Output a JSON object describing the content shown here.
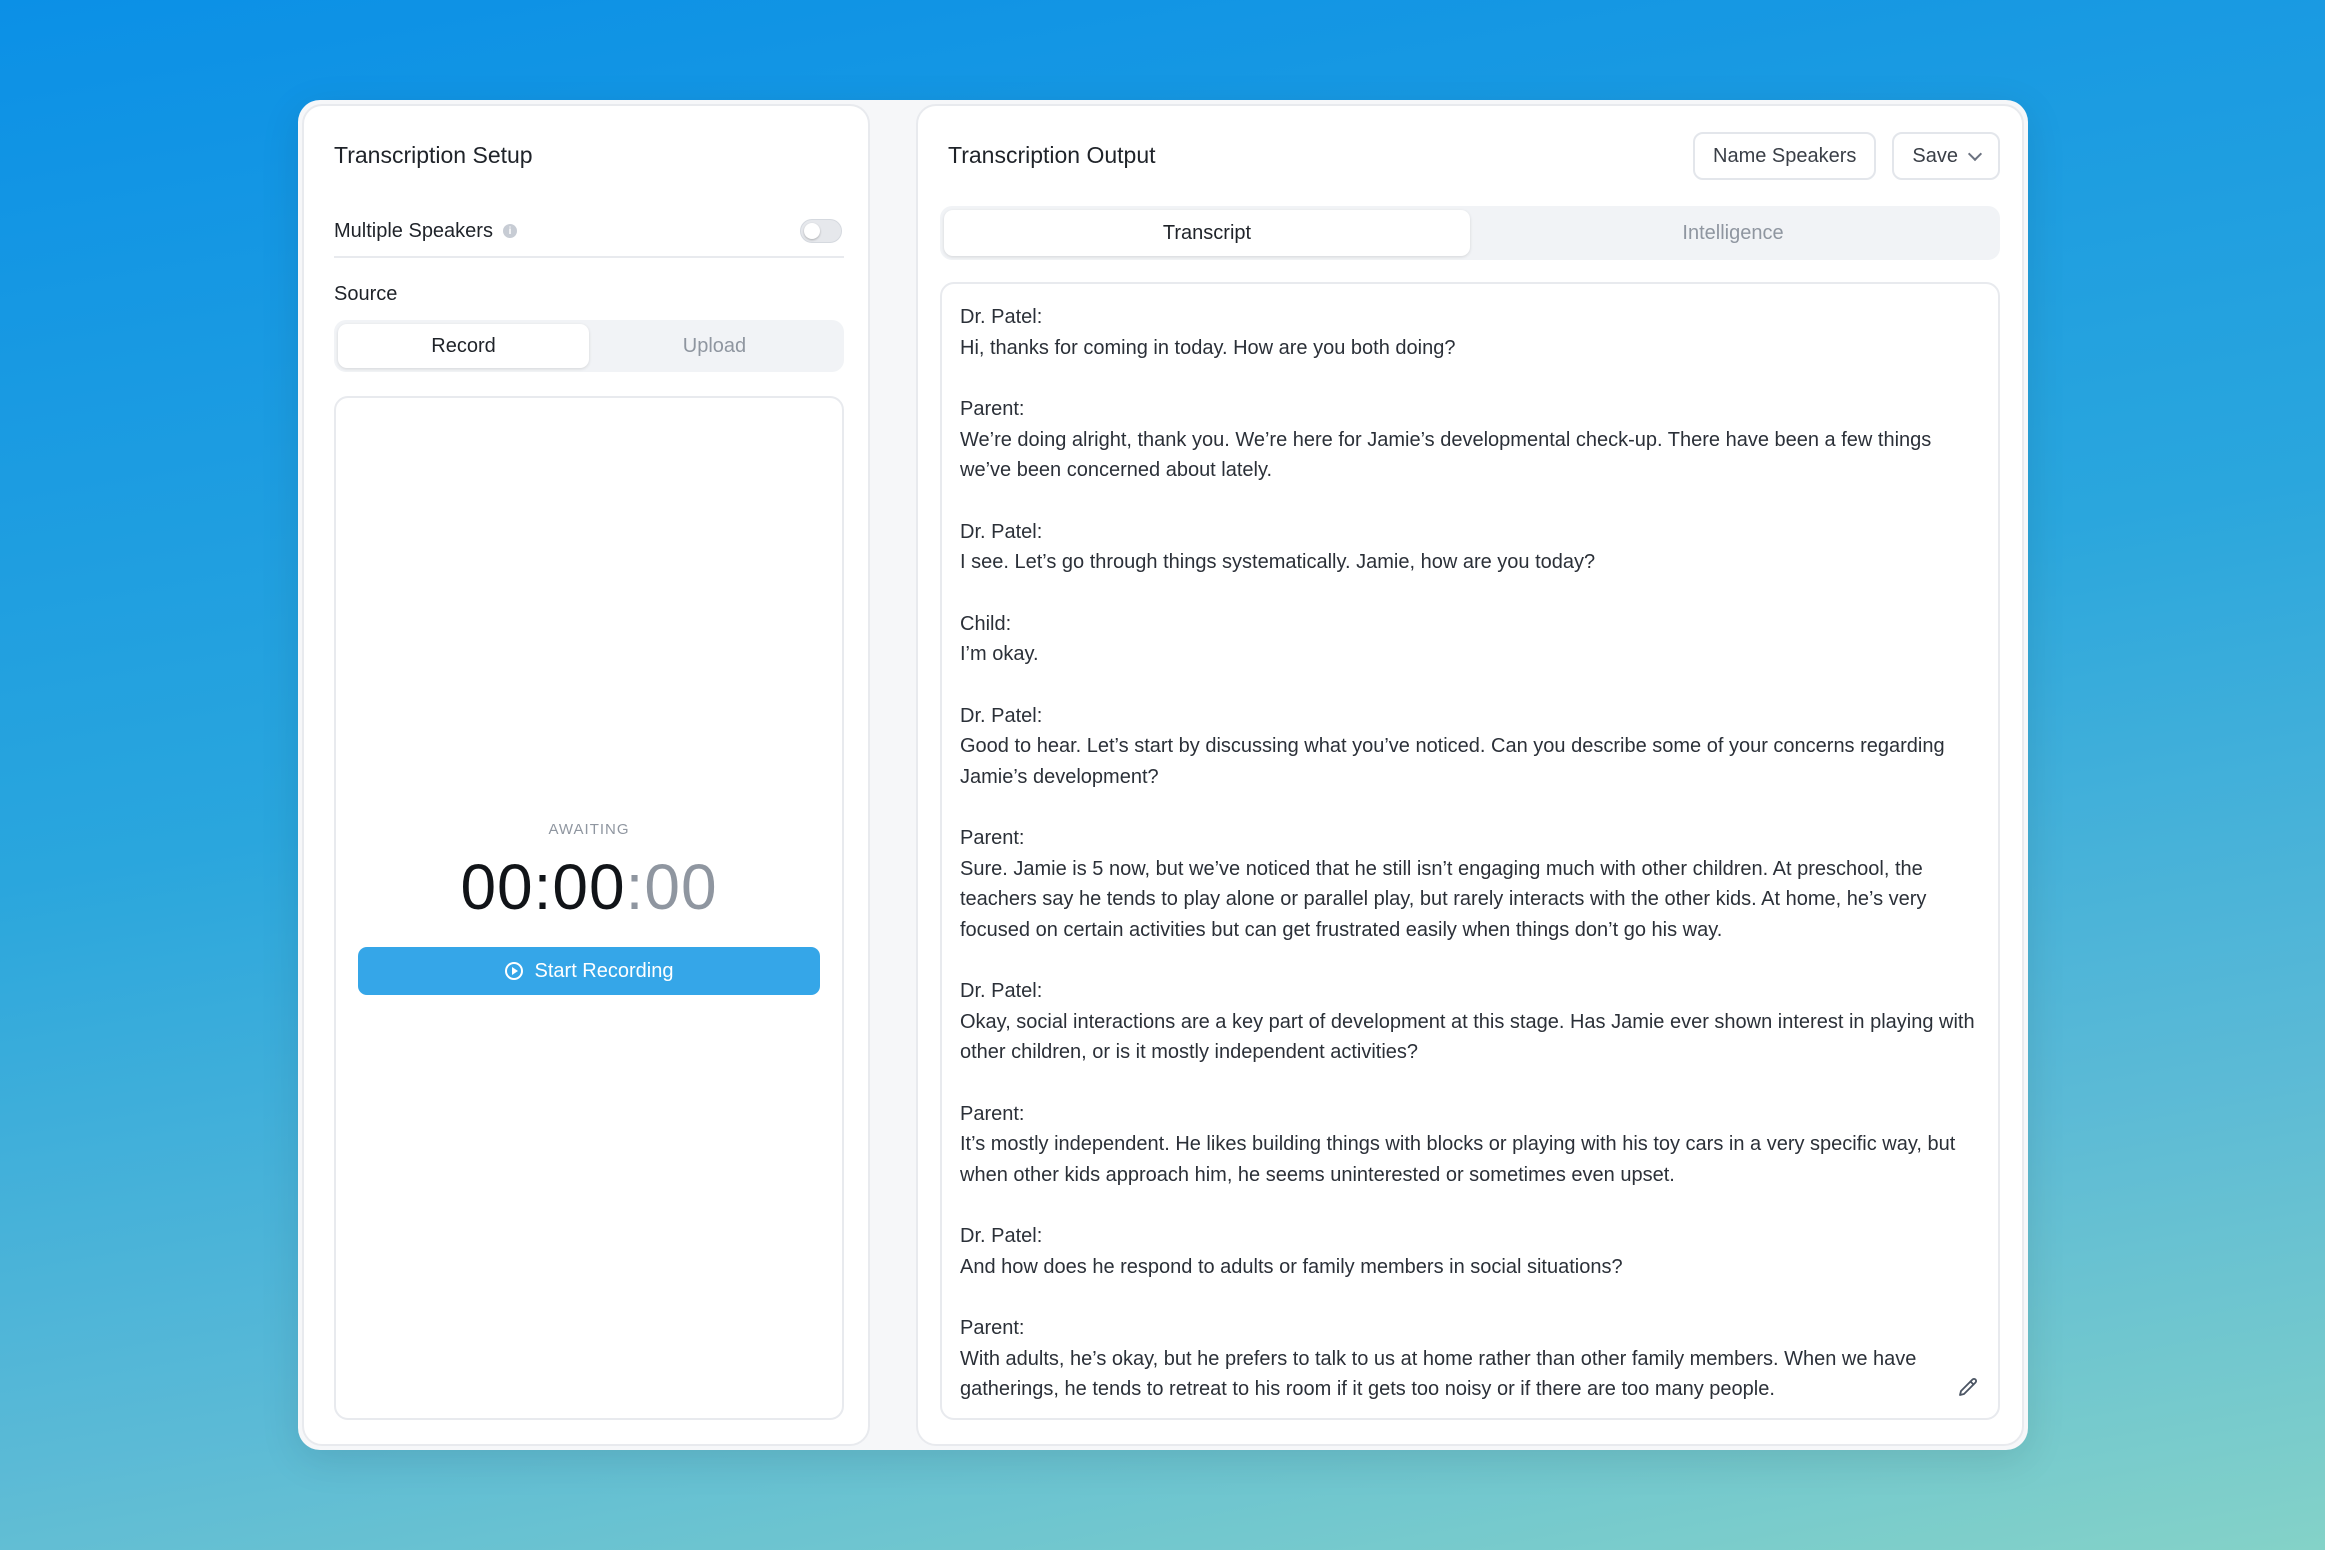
{
  "setup": {
    "title": "Transcription Setup",
    "multiple_speakers_label": "Multiple Speakers",
    "multiple_speakers_enabled": false,
    "source_label": "Source",
    "source_tabs": [
      {
        "label": "Record",
        "active": true
      },
      {
        "label": "Upload",
        "active": false
      }
    ],
    "status": "AWAITING",
    "timer_main": "00:00",
    "timer_sep": ":",
    "timer_fraction": "00",
    "start_button": "Start Recording"
  },
  "output": {
    "title": "Transcription Output",
    "name_speakers_button": "Name Speakers",
    "save_button": "Save",
    "tabs": [
      {
        "label": "Transcript",
        "active": true
      },
      {
        "label": "Intelligence",
        "active": false
      }
    ],
    "transcript": [
      {
        "speaker": "Dr. Patel:",
        "text": "Hi, thanks for coming in today. How are you both doing?"
      },
      {
        "speaker": "Parent:",
        "text": "We’re doing alright, thank you. We’re here for Jamie’s developmental check-up. There have been a few things we’ve been concerned about lately."
      },
      {
        "speaker": "Dr. Patel:",
        "text": "I see. Let’s go through things systematically. Jamie, how are you today?"
      },
      {
        "speaker": "Child:",
        "text": "I’m okay."
      },
      {
        "speaker": "Dr. Patel:",
        "text": "Good to hear. Let’s start by discussing what you’ve noticed. Can you describe some of your concerns regarding Jamie’s development?"
      },
      {
        "speaker": "Parent:",
        "text": "Sure. Jamie is 5 now, but we’ve noticed that he still isn’t engaging much with other children. At preschool, the teachers say he tends to play alone or parallel play, but rarely interacts with the other kids. At home, he’s very focused on certain activities but can get frustrated easily when things don’t go his way."
      },
      {
        "speaker": "Dr. Patel:",
        "text": "Okay, social interactions are a key part of development at this stage. Has Jamie ever shown interest in playing with other children, or is it mostly independent activities?"
      },
      {
        "speaker": "Parent:",
        "text": "It’s mostly independent. He likes building things with blocks or playing with his toy cars in a very specific way, but when other kids approach him, he seems uninterested or sometimes even upset."
      },
      {
        "speaker": "Dr. Patel:",
        "text": "And how does he respond to adults or family members in social situations?"
      },
      {
        "speaker": "Parent:",
        "text": "With adults, he’s okay, but he prefers to talk to us at home rather than other family members. When we have gatherings, he tends to retreat to his room if it gets too noisy or if there are too many people."
      }
    ]
  }
}
